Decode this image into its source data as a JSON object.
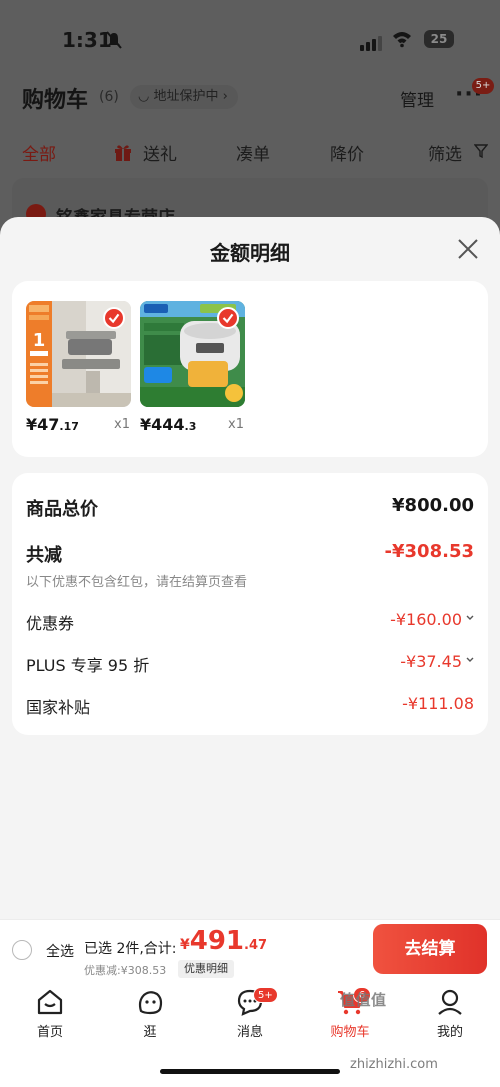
{
  "status_bar": {
    "time": "1:31",
    "battery": "25"
  },
  "header": {
    "title": "购物车",
    "count": "(6)",
    "address_protect": "地址保护中",
    "manage": "管理",
    "more_badge": "5+"
  },
  "tabs": [
    {
      "label": "全部",
      "active": true
    },
    {
      "label": "送礼"
    },
    {
      "label": "凑单"
    },
    {
      "label": "降价"
    },
    {
      "label": "筛选"
    }
  ],
  "shop": {
    "name": "铭鑫家具专营店"
  },
  "sheet": {
    "title": "金额明细",
    "products": [
      {
        "price_int": "¥47",
        "price_dec": ".17",
        "qty": "x1",
        "image": "shoe-rack-product"
      },
      {
        "price_int": "¥444",
        "price_dec": ".3",
        "qty": "x1",
        "image": "midea-rice-cooker-product"
      }
    ],
    "breakdown": {
      "subtotal_label": "商品总价",
      "subtotal_value": "¥800.00",
      "reduction_label": "共减",
      "reduction_value": "-¥308.53",
      "reduction_note": "以下优惠不包含红包，请在结算页查看",
      "items": [
        {
          "label": "优惠券",
          "value": "-¥160.00",
          "expandable": true
        },
        {
          "label": "PLUS 专享 95 折",
          "value": "-¥37.45",
          "expandable": true
        },
        {
          "label": "国家补贴",
          "value": "-¥111.08",
          "expandable": false
        }
      ]
    }
  },
  "checkout": {
    "select_all": "全选",
    "selected_summary": "已选 2件,合计:",
    "total_currency": "¥",
    "total_int": "491",
    "total_dec": ".47",
    "discount": "优惠减:¥308.53",
    "detail_button": "优惠明细",
    "pay_button": "去结算"
  },
  "tabbar": [
    {
      "label": "首页",
      "icon": "home-icon"
    },
    {
      "label": "逛",
      "icon": "browse-icon"
    },
    {
      "label": "消息",
      "icon": "message-icon",
      "badge": "5+"
    },
    {
      "label": "购物车",
      "icon": "cart-icon",
      "badge": "6",
      "active": true
    },
    {
      "label": "我的",
      "icon": "profile-icon"
    }
  ],
  "watermark": {
    "text": "值值值",
    "url": "zhizhizhi.com"
  },
  "colors": {
    "accent": "#e8382c",
    "background": "#f4f4f4"
  }
}
